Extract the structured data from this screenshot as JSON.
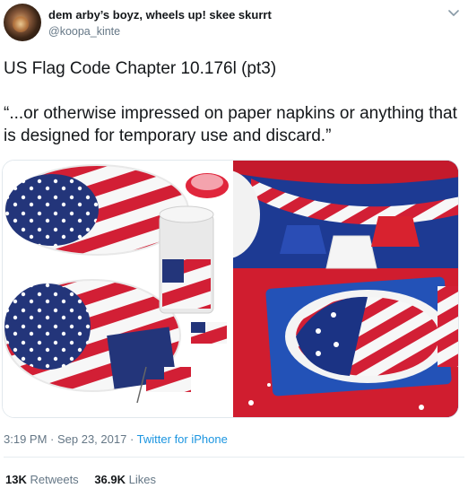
{
  "user": {
    "display_name": "dem arby’s boyz, wheels up! skee skurrt",
    "handle": "@koopa_kinte"
  },
  "tweet": {
    "line1": "US Flag Code Chapter 10.176l (pt3)",
    "line2": "“...or otherwise impressed on paper napkins or anything that is designed for temporary use and discard.”"
  },
  "meta": {
    "time": "3:19 PM",
    "separator1": " · ",
    "date": "Sep 23, 2017",
    "separator2": " · ",
    "source": "Twitter for iPhone"
  },
  "stats": {
    "retweets_count": "13K",
    "retweets_label": "Retweets",
    "likes_count": "36.9K",
    "likes_label": "Likes"
  },
  "icons": {
    "menu": "chevron-down-icon"
  },
  "colors": {
    "link": "#1b95e0",
    "secondary": "#657786",
    "flag_red": "#c8102e",
    "flag_blue": "#1b3b8c"
  }
}
